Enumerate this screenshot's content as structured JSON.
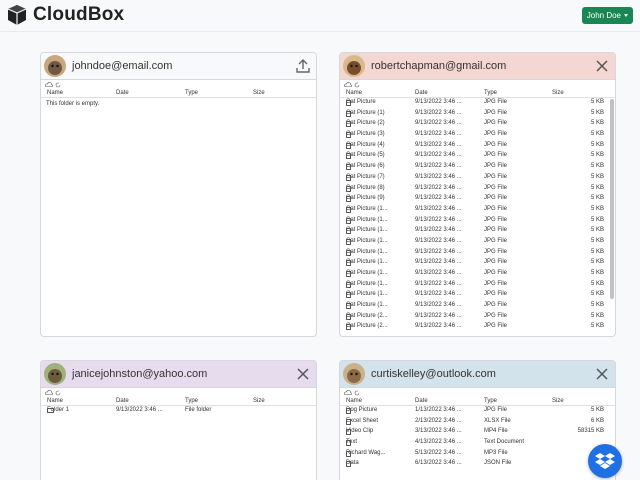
{
  "app": {
    "title": "CloudBox",
    "user_button": "John Doe"
  },
  "columns": {
    "name": "Name",
    "date": "Date",
    "type": "Type",
    "size": "Size"
  },
  "panels": [
    {
      "email": "johndoe@email.com",
      "header_color": "#f8f9fa",
      "action_icon": "upload-icon",
      "empty_message": "This folder is empty.",
      "rows": []
    },
    {
      "email": "robertchapman@gmail.com",
      "header_color": "#f4d6d3",
      "action_icon": "close-icon",
      "rows": [
        {
          "name": "Cat Picture",
          "date": "9/13/2022 3:46 ...",
          "type": "JPG File",
          "size": "5 KB"
        },
        {
          "name": "Cat Picture (1)",
          "date": "9/13/2022 3:46 ...",
          "type": "JPG File",
          "size": "5 KB"
        },
        {
          "name": "Cat Picture (2)",
          "date": "9/13/2022 3:46 ...",
          "type": "JPG File",
          "size": "5 KB"
        },
        {
          "name": "Cat Picture (3)",
          "date": "9/13/2022 3:46 ...",
          "type": "JPG File",
          "size": "5 KB"
        },
        {
          "name": "Cat Picture (4)",
          "date": "9/13/2022 3:46 ...",
          "type": "JPG File",
          "size": "5 KB"
        },
        {
          "name": "Cat Picture (5)",
          "date": "9/13/2022 3:46 ...",
          "type": "JPG File",
          "size": "5 KB"
        },
        {
          "name": "Cat Picture (6)",
          "date": "9/13/2022 3:46 ...",
          "type": "JPG File",
          "size": "5 KB"
        },
        {
          "name": "Cat Picture (7)",
          "date": "9/13/2022 3:46 ...",
          "type": "JPG File",
          "size": "5 KB"
        },
        {
          "name": "Cat Picture (8)",
          "date": "9/13/2022 3:46 ...",
          "type": "JPG File",
          "size": "5 KB"
        },
        {
          "name": "Cat Picture (9)",
          "date": "9/13/2022 3:46 ...",
          "type": "JPG File",
          "size": "5 KB"
        },
        {
          "name": "Cat Picture (1...",
          "date": "9/13/2022 3:46 ...",
          "type": "JPG File",
          "size": "5 KB"
        },
        {
          "name": "Cat Picture (1...",
          "date": "9/13/2022 3:46 ...",
          "type": "JPG File",
          "size": "5 KB"
        },
        {
          "name": "Cat Picture (1...",
          "date": "9/13/2022 3:46 ...",
          "type": "JPG File",
          "size": "5 KB"
        },
        {
          "name": "Cat Picture (1...",
          "date": "9/13/2022 3:46 ...",
          "type": "JPG File",
          "size": "5 KB"
        },
        {
          "name": "Cat Picture (1...",
          "date": "9/13/2022 3:46 ...",
          "type": "JPG File",
          "size": "5 KB"
        },
        {
          "name": "Cat Picture (1...",
          "date": "9/13/2022 3:46 ...",
          "type": "JPG File",
          "size": "5 KB"
        },
        {
          "name": "Cat Picture (1...",
          "date": "9/13/2022 3:46 ...",
          "type": "JPG File",
          "size": "5 KB"
        },
        {
          "name": "Cat Picture (1...",
          "date": "9/13/2022 3:46 ...",
          "type": "JPG File",
          "size": "5 KB"
        },
        {
          "name": "Cat Picture (1...",
          "date": "9/13/2022 3:46 ...",
          "type": "JPG File",
          "size": "5 KB"
        },
        {
          "name": "Cat Picture (1...",
          "date": "9/13/2022 3:46 ...",
          "type": "JPG File",
          "size": "5 KB"
        },
        {
          "name": "Cat Picture (2...",
          "date": "9/13/2022 3:46 ...",
          "type": "JPG File",
          "size": "5 KB"
        },
        {
          "name": "Cat Picture (2...",
          "date": "9/13/2022 3:46 ...",
          "type": "JPG File",
          "size": "5 KB"
        }
      ]
    },
    {
      "email": "janicejohnston@yahoo.com",
      "header_color": "#e7dcee",
      "action_icon": "close-icon",
      "rows": [
        {
          "name": "Folder 1",
          "date": "9/13/2022 3:46 ...",
          "type": "File folder",
          "size": "",
          "folder": true
        }
      ]
    },
    {
      "email": "curtiskelley@outlook.com",
      "header_color": "#d2e3ec",
      "action_icon": "close-icon",
      "rows": [
        {
          "name": "Dog Picture",
          "date": "1/13/2022 3:46 ...",
          "type": "JPG File",
          "size": "5 KB"
        },
        {
          "name": "Excel Sheet",
          "date": "2/13/2022 3:46 ...",
          "type": "XLSX File",
          "size": "6 KB"
        },
        {
          "name": "Video Clip",
          "date": "3/13/2022 3:46 ...",
          "type": "MP4 File",
          "size": "58315 KB"
        },
        {
          "name": "Text",
          "date": "4/13/2022 3:46 ...",
          "type": "Text Document",
          "size": ""
        },
        {
          "name": "Richard Wag...",
          "date": "5/13/2022 3:46 ...",
          "type": "MP3 File",
          "size": "6..."
        },
        {
          "name": "Data",
          "date": "6/13/2022 3:46 ...",
          "type": "JSON File",
          "size": ""
        }
      ]
    }
  ]
}
